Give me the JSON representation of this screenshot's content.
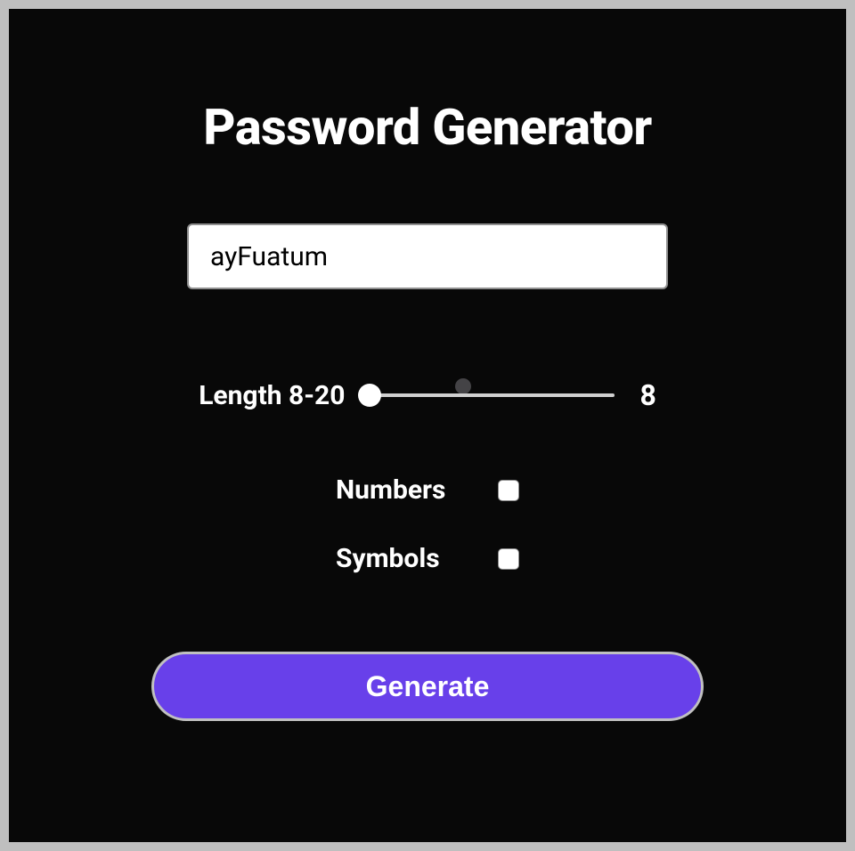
{
  "title": "Password Generator",
  "password": {
    "value": "ayFuatum"
  },
  "length": {
    "label": "Length 8-20",
    "value": "8",
    "min": 8,
    "max": 20
  },
  "options": {
    "numbers": {
      "label": "Numbers",
      "checked": false
    },
    "symbols": {
      "label": "Symbols",
      "checked": false
    }
  },
  "button": {
    "generate": "Generate"
  },
  "colors": {
    "accent": "#6840ea",
    "background": "#080808"
  }
}
